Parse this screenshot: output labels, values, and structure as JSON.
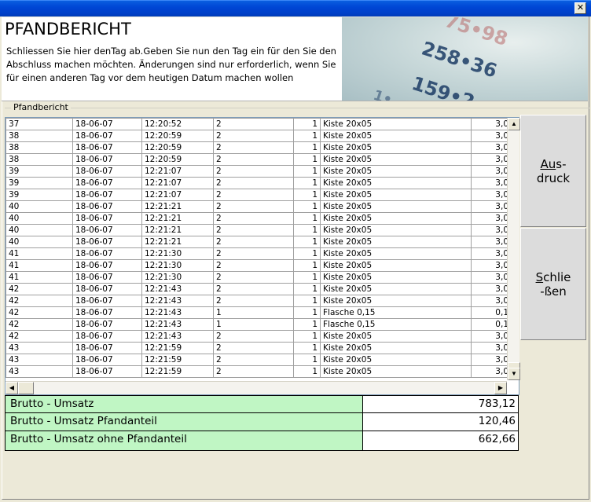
{
  "window": {
    "close_glyph": "✕"
  },
  "header": {
    "title": "PFANDBERICHT",
    "instructions": "Schliessen Sie hier denTag ab.Geben Sie nun den Tag ein für den Sie den Abschluss machen möchten.  Änderungen sind nur erforderlich, wenn Sie für einen anderen Tag vor dem heutigen Datum machen wollen",
    "image_numbers": [
      "75•98",
      "258•36",
      "159•2",
      "1•"
    ]
  },
  "group": {
    "label": "Pfandbericht"
  },
  "table": {
    "rows": [
      [
        "37",
        "18-06-07",
        "12:20:52",
        "2",
        "1",
        "Kiste 20x05",
        "3,0"
      ],
      [
        "38",
        "18-06-07",
        "12:20:59",
        "2",
        "1",
        "Kiste 20x05",
        "3,0"
      ],
      [
        "38",
        "18-06-07",
        "12:20:59",
        "2",
        "1",
        "Kiste 20x05",
        "3,0"
      ],
      [
        "38",
        "18-06-07",
        "12:20:59",
        "2",
        "1",
        "Kiste 20x05",
        "3,0"
      ],
      [
        "39",
        "18-06-07",
        "12:21:07",
        "2",
        "1",
        "Kiste 20x05",
        "3,0"
      ],
      [
        "39",
        "18-06-07",
        "12:21:07",
        "2",
        "1",
        "Kiste 20x05",
        "3,0"
      ],
      [
        "39",
        "18-06-07",
        "12:21:07",
        "2",
        "1",
        "Kiste 20x05",
        "3,0"
      ],
      [
        "40",
        "18-06-07",
        "12:21:21",
        "2",
        "1",
        "Kiste 20x05",
        "3,0"
      ],
      [
        "40",
        "18-06-07",
        "12:21:21",
        "2",
        "1",
        "Kiste 20x05",
        "3,0"
      ],
      [
        "40",
        "18-06-07",
        "12:21:21",
        "2",
        "1",
        "Kiste 20x05",
        "3,0"
      ],
      [
        "40",
        "18-06-07",
        "12:21:21",
        "2",
        "1",
        "Kiste 20x05",
        "3,0"
      ],
      [
        "41",
        "18-06-07",
        "12:21:30",
        "2",
        "1",
        "Kiste 20x05",
        "3,0"
      ],
      [
        "41",
        "18-06-07",
        "12:21:30",
        "2",
        "1",
        "Kiste 20x05",
        "3,0"
      ],
      [
        "41",
        "18-06-07",
        "12:21:30",
        "2",
        "1",
        "Kiste 20x05",
        "3,0"
      ],
      [
        "42",
        "18-06-07",
        "12:21:43",
        "2",
        "1",
        "Kiste 20x05",
        "3,0"
      ],
      [
        "42",
        "18-06-07",
        "12:21:43",
        "2",
        "1",
        "Kiste 20x05",
        "3,0"
      ],
      [
        "42",
        "18-06-07",
        "12:21:43",
        "1",
        "1",
        "Flasche 0,15",
        "0,1"
      ],
      [
        "42",
        "18-06-07",
        "12:21:43",
        "1",
        "1",
        "Flasche 0,15",
        "0,1"
      ],
      [
        "42",
        "18-06-07",
        "12:21:43",
        "2",
        "1",
        "Kiste 20x05",
        "3,0"
      ],
      [
        "43",
        "18-06-07",
        "12:21:59",
        "2",
        "1",
        "Kiste 20x05",
        "3,0"
      ],
      [
        "43",
        "18-06-07",
        "12:21:59",
        "2",
        "1",
        "Kiste 20x05",
        "3,0"
      ],
      [
        "43",
        "18-06-07",
        "12:21:59",
        "2",
        "1",
        "Kiste 20x05",
        "3,0"
      ]
    ]
  },
  "buttons": {
    "print_line1_underlined": "Au",
    "print_line1_rest": "s-",
    "print_line2": "druck",
    "close_line1_underlined": "S",
    "close_line1_rest": "chlie",
    "close_line2": "-ßen"
  },
  "scroll": {
    "up": "▲",
    "down": "▼",
    "left": "◀",
    "right": "▶"
  },
  "summary": {
    "rows": [
      {
        "label": "Brutto - Umsatz",
        "value": "783,12"
      },
      {
        "label": "Brutto - Umsatz Pfandanteil",
        "value": "120,46"
      },
      {
        "label": "Brutto - Umsatz ohne Pfandanteil",
        "value": "662,66"
      }
    ]
  },
  "colors": {
    "summary_label_bg": "#c0f6c4",
    "titlebar_blue": "#0046d5",
    "window_bg": "#ece9d8"
  }
}
